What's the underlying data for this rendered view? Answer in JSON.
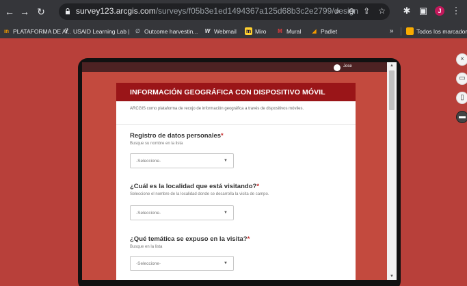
{
  "browser": {
    "url_host": "survey123.arcgis.com",
    "url_path": "/surveys/f05b3e1ed1494367a125d68b3c2e2799/design",
    "bookmarks": [
      {
        "label": "PLATAFORMA DE A...",
        "icon": "plataforma-icon",
        "color": "#f29900"
      },
      {
        "label": "USAID Learning Lab |",
        "icon": "usaid-icon",
        "color": "#e8eaed"
      },
      {
        "label": "Outcome harvestin...",
        "icon": "outcome-icon",
        "color": "#9aa0a6"
      },
      {
        "label": "Webmail",
        "icon": "webmail-icon",
        "color": "#e8eaed"
      },
      {
        "label": "Miro",
        "icon": "miro-icon",
        "color": "#ffd02f"
      },
      {
        "label": "Mural",
        "icon": "mural-icon",
        "color": "#e03c3c"
      },
      {
        "label": "Padlet",
        "icon": "padlet-icon",
        "color": "#f29900"
      }
    ],
    "overflow": "»",
    "all_bookmarks_label": "Todos los marcadores",
    "profile_initial": "J"
  },
  "app": {
    "username": "Jose"
  },
  "form": {
    "title": "INFORMACIÓN GEOGRÁFICA CON DISPOSITIVO MÓVIL",
    "description": "ARCGIS como plataforma de recojo de información geográfica a través de dispositivos móviles.",
    "questions": [
      {
        "title": "Registro de datos personales",
        "required": "*",
        "hint": "Busque su nombre en la lista",
        "placeholder": "-Seleccione-"
      },
      {
        "title": "¿Cuál es la localidad que está visitando?",
        "required": "*",
        "hint": "Seleccione el nombre de la localidad donde se desarrolla la visita de campo.",
        "placeholder": "-Seleccione-"
      },
      {
        "title": "¿Qué temática se expuso en la visita?",
        "required": "*",
        "hint": "Busque en la lista",
        "placeholder": "-Seleccione-"
      }
    ]
  },
  "colors": {
    "page_bg": "#b8403a",
    "form_header": "#9a1518",
    "required": "#c62828"
  }
}
